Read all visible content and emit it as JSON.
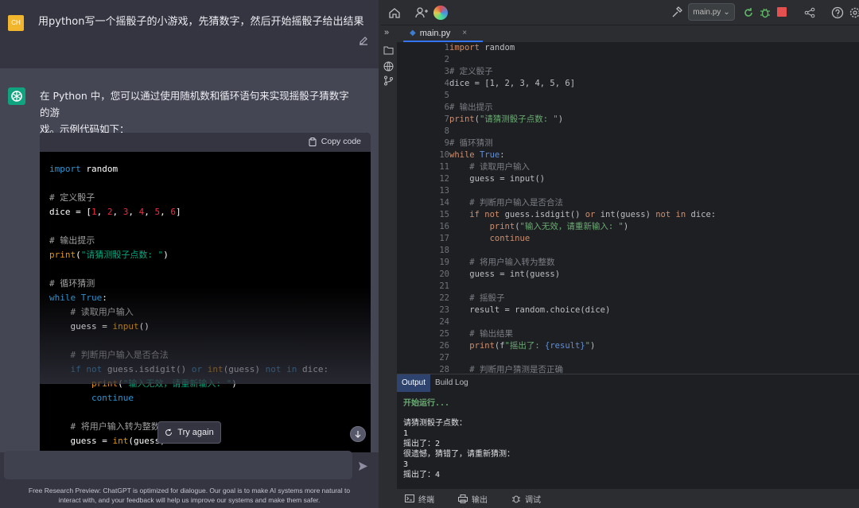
{
  "chat": {
    "user_avatar": "CH",
    "user_message": "用python写一个摇骰子的小游戏，先猜数字，然后开始摇骰子给出结果",
    "bot_reply_line1": "在 Python 中，您可以通过使用随机数和循环语句来实现摇骰子猜数字的游",
    "bot_reply_line2": "戏。示例代码如下：",
    "copy_label": "Copy code",
    "try_again_label": "Try again",
    "footer_line1": "Free Research Preview: ChatGPT is optimized for dialogue. Our goal is to make AI systems more natural to",
    "footer_line2": "interact with, and your feedback will help us improve our systems and make them safer."
  },
  "ide": {
    "run_config": "main.py",
    "tab_label": "main.py",
    "tab_close": "×",
    "output_tab": "Output",
    "build_log_tab": "Build Log",
    "run_header": "开始运行...",
    "output_lines": [
      "请猜测骰子点数：",
      "1",
      "摇出了：2",
      "很遗憾，猜错了，请重新猜测：",
      "3",
      "摇出了：4"
    ],
    "status_terminal": "终端",
    "status_output": "输出",
    "status_debug": "调试"
  },
  "colors": {
    "chatgpt_green": "#10a37f",
    "user_avatar_bg": "#f1b62c",
    "accent_blue": "#3574f0"
  }
}
